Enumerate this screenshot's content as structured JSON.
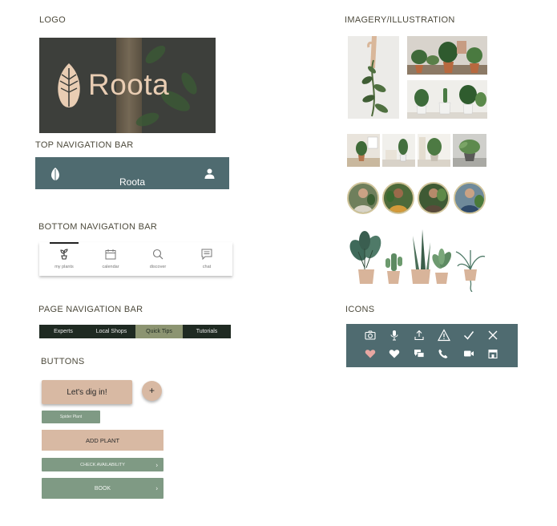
{
  "sections": {
    "logo": "LOGO",
    "top_nav": "TOP NAVIGATION BAR",
    "bottom_nav": "BOTTOM NAVIGATION BAR",
    "page_nav": "PAGE NAVIGATION BAR",
    "buttons": "BUTTONS",
    "imagery": "IMAGERY/ILLUSTRATION",
    "icons": "ICONS"
  },
  "logo": {
    "text": "Roota"
  },
  "top_nav": {
    "brand": "Roota",
    "icons": [
      "leaf-icon",
      "user-icon"
    ]
  },
  "bottom_nav": {
    "items": [
      {
        "label": "my plants",
        "icon": "plant-icon",
        "active": true
      },
      {
        "label": "calendar",
        "icon": "calendar-icon"
      },
      {
        "label": "discover",
        "icon": "search-icon"
      },
      {
        "label": "chat",
        "icon": "chat-icon"
      }
    ]
  },
  "page_nav": {
    "items": [
      {
        "label": "Experts"
      },
      {
        "label": "Local Shops"
      },
      {
        "label": "Quick Tips",
        "active": true
      },
      {
        "label": "Tutorials"
      }
    ]
  },
  "buttons": {
    "dig_in": "Let's dig in!",
    "plus": "+",
    "spider_plant": "Spider Plant",
    "add_plant": "ADD PLANT",
    "check_availability": "CHECK AVAILABILITY",
    "book": "BOOK",
    "chevron": "›"
  },
  "icons": {
    "row1": [
      "camera-icon",
      "microphone-icon",
      "upload-icon",
      "warning-icon",
      "check-icon",
      "close-icon"
    ],
    "row2": [
      "heart-filled-pink-icon",
      "heart-icon",
      "messages-icon",
      "phone-icon",
      "video-icon",
      "store-icon"
    ]
  },
  "colors": {
    "nav_teal": "#4f6b70",
    "beige": "#d8b9a3",
    "sage": "#7f9a84",
    "olive_active": "#8c9471",
    "dark": "#1f2a22",
    "pink": "#e8a7a2"
  }
}
